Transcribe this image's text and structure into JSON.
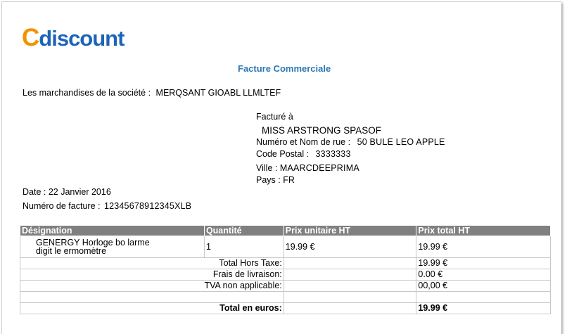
{
  "logo": {
    "first_letter": "C",
    "rest": "discount"
  },
  "title": "Facture Commerciale",
  "seller": {
    "label": "Les marchandises de la société :",
    "value": "MERQSANT GIOABL LLMLTEF"
  },
  "billing": {
    "heading": "Facturé à",
    "name": "MISS ARSTRONG SPASOF",
    "street_label": "Numéro et Nom de rue :",
    "street_value": "50 BULE LEO APPLE",
    "postal_label": "Code Postal :",
    "postal_value": "3333333",
    "city_label": "Ville :",
    "city_value": "MAARCDEEPRIMA",
    "country": "Pays : FR"
  },
  "date": "Date : 22 Janvier 2016",
  "invoice_number": {
    "label": "Numéro de facture :",
    "value": "12345678912345XLB"
  },
  "table": {
    "headers": [
      "Désignation",
      "Quantité",
      "Prix unitaire HT",
      "Prix total HT"
    ],
    "item": {
      "designation_line1": "GENERGY Horloge bo larme",
      "designation_line2": "digit le ermomètre",
      "quantity": "1",
      "unit_price": "19.99 €",
      "total_price": "19.99 €"
    },
    "totals": [
      {
        "label": "Total Hors Taxe:",
        "value": "19.99 €"
      },
      {
        "label": "Frais de livraison:",
        "value": "0.00 €"
      },
      {
        "label": "TVA non applicable:",
        "value": "00,00 €"
      }
    ],
    "grand_total": {
      "label": "Total en euros:",
      "value": "19.99 €"
    }
  },
  "colors": {
    "logo_orange": "#f39200",
    "logo_blue": "#1d64b7",
    "title_blue": "#2e78b5",
    "header_gray": "#808080"
  }
}
